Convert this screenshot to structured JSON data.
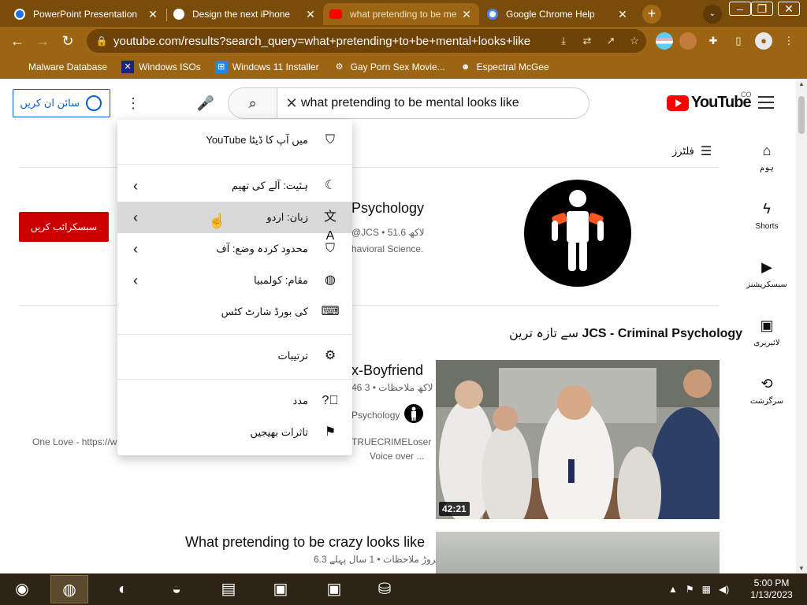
{
  "browser": {
    "tabs": [
      {
        "title": "PowerPoint Presentation",
        "favicon_color": "#1a73e8",
        "active": false
      },
      {
        "title": "Design the next iPhone",
        "favicon_color": "#ffffff",
        "active": false
      },
      {
        "title": "what pretending to be me",
        "favicon_color": "#ff0000",
        "active": true
      },
      {
        "title": "Google Chrome Help",
        "favicon_color": "#ffffff",
        "active": false
      }
    ],
    "new_tab": "+",
    "url": "youtube.com/results?search_query=what+pretending+to+be+mental+looks+like",
    "bookmarks": [
      {
        "label": "Malware Database",
        "icon": "folder-icon"
      },
      {
        "label": "Windows ISOs",
        "icon": "x-icon"
      },
      {
        "label": "Windows 11 Installer",
        "icon": "windows-icon"
      },
      {
        "label": "Gay Porn Sex Movie...",
        "icon": "gear-icon"
      },
      {
        "label": "Espectral McGee",
        "icon": "person-icon"
      }
    ],
    "accent_color": "#9b6513"
  },
  "youtube": {
    "signin_label": "سائن ان کریں",
    "search_query": "what pretending to be mental looks like",
    "logo_text": "YouTube",
    "country_code": "CO",
    "filters_label": "فلٹرز",
    "miniguide": [
      {
        "label": "ہوم",
        "icon": "home-icon"
      },
      {
        "label": "Shorts",
        "icon": "shorts-icon"
      },
      {
        "label": "سبسکرپشنز",
        "icon": "subscriptions-icon"
      },
      {
        "label": "لائبریری",
        "icon": "library-icon"
      },
      {
        "label": "سرگزشت",
        "icon": "history-icon"
      }
    ],
    "channel": {
      "title_fragment": "Psychology",
      "meta": "@JCS • 51.6 لاکھ",
      "desc": "havioral Science.",
      "subscribe_label": "سبسکرائب کریں"
    },
    "shelf": {
      "channel_name": "JCS - Criminal Psychology",
      "suffix": "سے تازہ ترین"
    },
    "video1": {
      "title_fragment": "x-Boyfriend",
      "meta": "46 لاکھ ملاحظات • 3",
      "channel_fragment": "Psychology",
      "desc1": "TRUECRIMELoser",
      "desc2": "Voice over ...",
      "duration": "42:21",
      "left_snippet": "One Love - https://w"
    },
    "video2": {
      "title": "What pretending to be crazy looks like",
      "meta": "6.3 کروڑ ملاحظات • 1 سال پہلے"
    }
  },
  "menu": {
    "items": [
      {
        "label": "YouTube میں آپ کا ڈیٹا",
        "icon": "shield-person-icon",
        "chevron": false
      },
      {
        "label": "ہئیت: آلے کی تھیم",
        "icon": "moon-icon",
        "chevron": true
      },
      {
        "label": "زبان: اردو",
        "icon": "translate-icon",
        "chevron": true,
        "hover": true
      },
      {
        "label": "محدود کردہ وضع: آف",
        "icon": "restricted-icon",
        "chevron": true
      },
      {
        "label": "مقام: کولمبیا",
        "icon": "globe-icon",
        "chevron": true
      },
      {
        "label": "کی بورڈ شارٹ کٹس",
        "icon": "keyboard-icon",
        "chevron": false
      },
      {
        "label": "ترتیبات",
        "icon": "gear-icon",
        "chevron": false
      },
      {
        "label": "مدد",
        "icon": "help-icon",
        "chevron": false
      },
      {
        "label": "تاثرات بھیجیں",
        "icon": "feedback-icon",
        "chevron": false
      }
    ]
  },
  "taskbar": {
    "time": "5:00 PM",
    "date": "1/13/2023",
    "apps": [
      "start-icon",
      "chrome-icon",
      "firefox-icon",
      "edge-icon",
      "explorer-icon",
      "installer-icon",
      "installer-icon",
      "network-icon"
    ]
  }
}
